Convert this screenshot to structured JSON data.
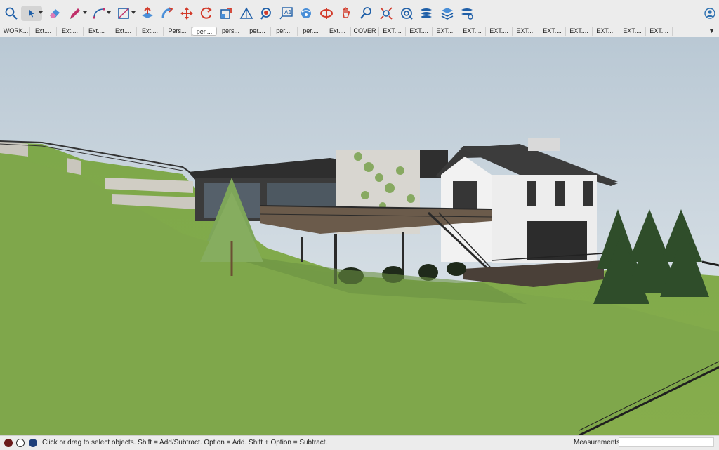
{
  "toolbar": {
    "tools": [
      {
        "name": "search-tool-icon"
      },
      {
        "name": "select-tool-icon"
      },
      {
        "name": "eraser-tool-icon"
      },
      {
        "name": "pencil-line-tool-icon"
      },
      {
        "name": "arc-tool-icon"
      },
      {
        "name": "shape-tool-icon"
      },
      {
        "name": "push-pull-tool-icon"
      },
      {
        "name": "follow-me-tool-icon"
      },
      {
        "name": "move-tool-icon"
      },
      {
        "name": "rotate-tool-icon"
      },
      {
        "name": "scale-tool-icon"
      },
      {
        "name": "tape-measure-tool-icon"
      },
      {
        "name": "paint-bucket-tool-icon"
      },
      {
        "name": "text-tool-icon"
      },
      {
        "name": "orbit-tool-icon"
      },
      {
        "name": "section-plane-tool-icon"
      },
      {
        "name": "pan-tool-icon"
      },
      {
        "name": "zoom-tool-icon"
      },
      {
        "name": "zoom-extents-tool-icon"
      },
      {
        "name": "components-panel-icon"
      },
      {
        "name": "tags-panel-icon"
      },
      {
        "name": "layers-panel-icon"
      },
      {
        "name": "styles-panel-icon"
      },
      {
        "name": "account-icon"
      }
    ]
  },
  "scene_tabs": {
    "items": [
      "WORK...",
      "Ext....",
      "Ext....",
      "Ext....",
      "Ext....",
      "Ext....",
      "Pers...",
      "per....",
      "pers...",
      "per....",
      "per....",
      "per....",
      "Ext....",
      "COVER",
      "EXT....",
      "EXT....",
      "EXT....",
      "EXT....",
      "EXT....",
      "EXT....",
      "EXT....",
      "EXT....",
      "EXT....",
      "EXT....",
      "EXT...."
    ],
    "active_index": 7,
    "more": "▼"
  },
  "statusbar": {
    "hint": "Click or drag to select objects. Shift = Add/Subtract. Option = Add. Shift + Option = Subtract.",
    "measurements_label": "Measurements",
    "measurements_value": ""
  }
}
